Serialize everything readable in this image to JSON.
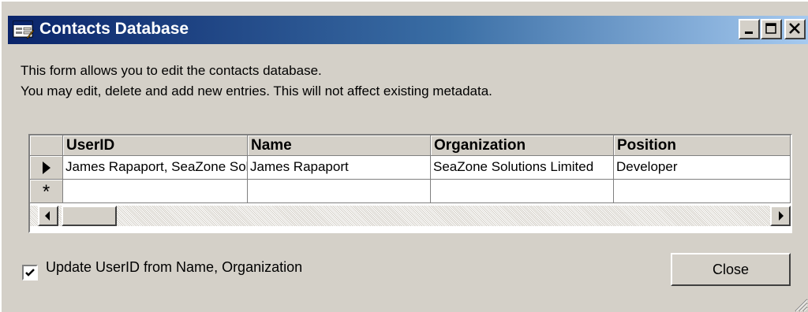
{
  "window": {
    "title": "Contacts Database"
  },
  "intro": {
    "line1": "This form allows you to edit the contacts database.",
    "line2": "You may edit, delete and add new entries. This will not affect existing metadata."
  },
  "grid": {
    "columns": [
      "UserID",
      "Name",
      "Organization",
      "Position"
    ],
    "rows": [
      [
        "James Rapaport, SeaZone Solutions Limited",
        "James Rapaport",
        "SeaZone Solutions Limited",
        "Developer"
      ]
    ],
    "new_row_marker": "*"
  },
  "options": {
    "update_userid_label": "Update UserID from Name, Organization",
    "update_userid_checked": true
  },
  "buttons": {
    "close_label": "Close"
  },
  "colors": {
    "titlebar_start": "#0a246a",
    "titlebar_end": "#a6caf0",
    "face": "#d4d0c8"
  }
}
